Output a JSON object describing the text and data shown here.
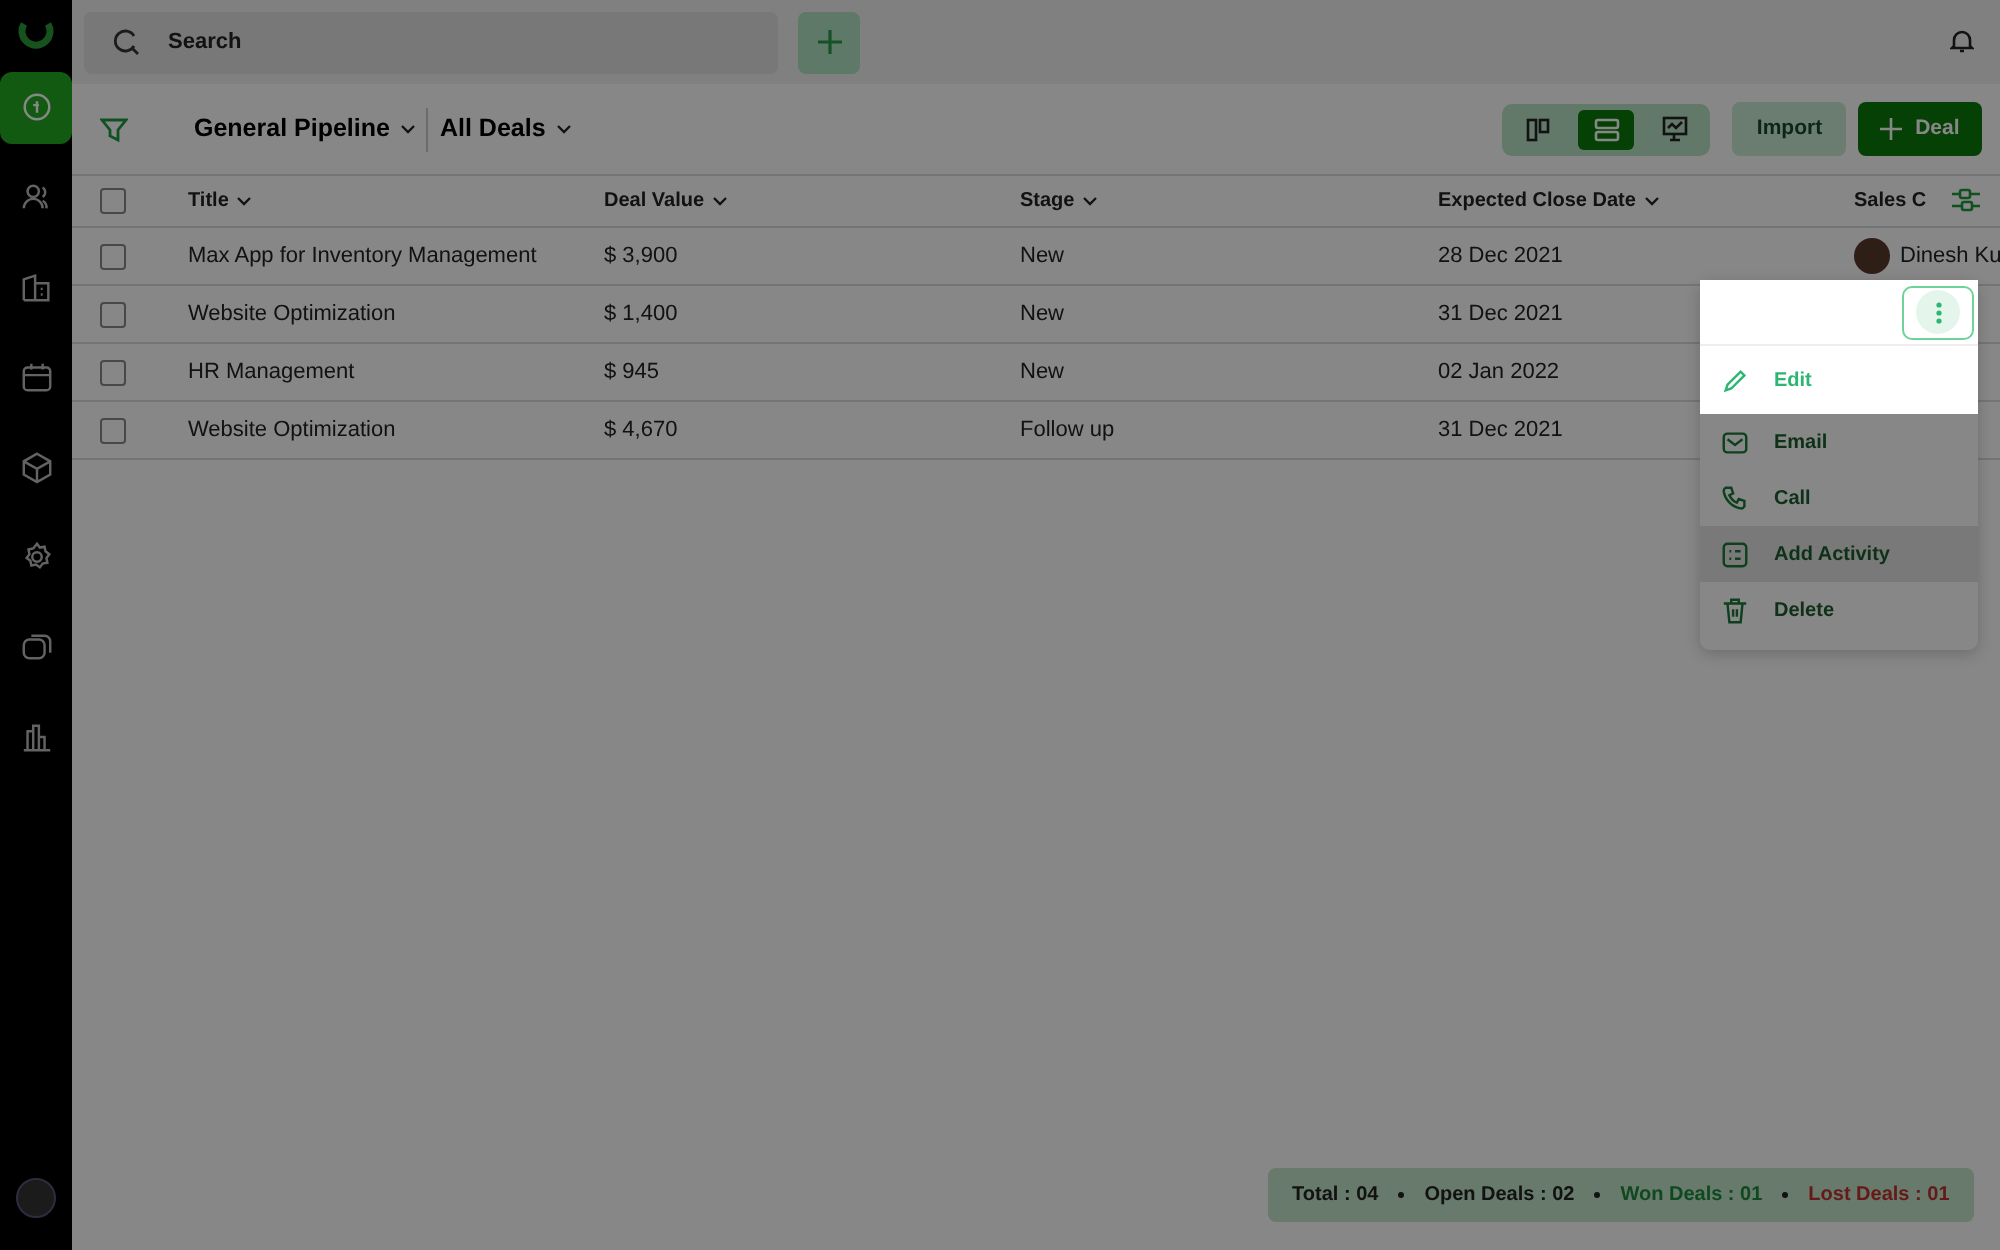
{
  "sidebar": {
    "items": [
      {
        "selected": true
      },
      {
        "selected": false
      },
      {
        "selected": false
      },
      {
        "selected": false
      },
      {
        "selected": false
      },
      {
        "selected": false
      },
      {
        "selected": false
      },
      {
        "selected": false
      }
    ]
  },
  "topbar": {
    "search": {
      "placeholder": "Search"
    }
  },
  "toolbar": {
    "pipeline": "General Pipeline",
    "filter": "All Deals",
    "views": [
      {
        "selected": false
      },
      {
        "selected": true
      },
      {
        "selected": false
      }
    ],
    "import_button": "Import",
    "add_button": "Deal"
  },
  "table": {
    "select_all_checked": false,
    "columns": [
      "Title",
      "Deal Value",
      "Stage",
      "Expected Close Date",
      "Sales C"
    ],
    "rows": [
      {
        "checked": false,
        "cells": [
          "Max App for Inventory Management",
          "$ 3,900",
          "New",
          "28 Dec 2021",
          "Dinesh Ku"
        ]
      },
      {
        "checked": false,
        "cells": [
          "Website Optimization",
          "$ 1,400",
          "New",
          "31 Dec 2021"
        ]
      },
      {
        "checked": false,
        "cells": [
          "HR Management",
          "$ 945",
          "New",
          "02 Jan 2022"
        ]
      },
      {
        "checked": false,
        "cells": [
          "Website Optimization",
          "$ 4,670",
          "Follow up",
          "31 Dec 2021"
        ]
      }
    ]
  },
  "row_menu": {
    "items": [
      {
        "label": "Edit",
        "highlighted": true,
        "hovered": false
      },
      {
        "label": "Email",
        "highlighted": false,
        "hovered": false
      },
      {
        "label": "Call",
        "highlighted": false,
        "hovered": false
      },
      {
        "label": "Add Activity",
        "highlighted": false,
        "hovered": true
      },
      {
        "label": "Delete",
        "highlighted": false,
        "hovered": false
      }
    ]
  },
  "summary": [
    {
      "text": "Total : 04",
      "kind": "total"
    },
    {
      "text": "Open Deals : 02",
      "kind": "open"
    },
    {
      "text": "Won Deals : 01",
      "kind": "won"
    },
    {
      "text": "Lost Deals : 01",
      "kind": "lost"
    }
  ]
}
